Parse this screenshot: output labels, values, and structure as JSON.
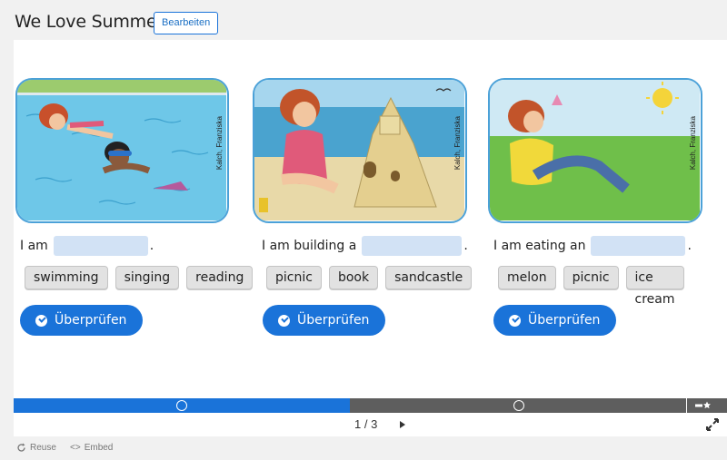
{
  "header": {
    "title": "We Love Summer",
    "edit_label": "Bearbeiten"
  },
  "cards": [
    {
      "credit": "Kalch, Franziska",
      "prefix": "I am",
      "suffix": ".",
      "options": [
        "swimming",
        "singing",
        "reading"
      ],
      "check_label": "Überprüfen"
    },
    {
      "credit": "Kalch, Franziska",
      "prefix": "I am building a",
      "suffix": ".",
      "options": [
        "picnic",
        "book",
        "sandcastle"
      ],
      "check_label": "Überprüfen"
    },
    {
      "credit": "Kalch, Franziska",
      "prefix": "I am eating an",
      "suffix": ".",
      "options": [
        "melon",
        "picnic",
        "ice cream"
      ],
      "check_label": "Überprüfen"
    }
  ],
  "progress": {
    "current": 1,
    "total": 3,
    "fraction": 0.5
  },
  "nav": {
    "current": "1",
    "separator": "/",
    "total": "3"
  },
  "footer": {
    "reuse": "Reuse",
    "embed": "Embed"
  },
  "colors": {
    "accent": "#1a73d9",
    "blank": "#d2e2f5",
    "frame": "#4ba1d8",
    "progress_track": "#5e5e5e"
  },
  "icons": [
    "check-circle-icon",
    "next-arrow-icon",
    "fullscreen-icon",
    "summary-star-icon",
    "reuse-icon",
    "embed-icon"
  ]
}
